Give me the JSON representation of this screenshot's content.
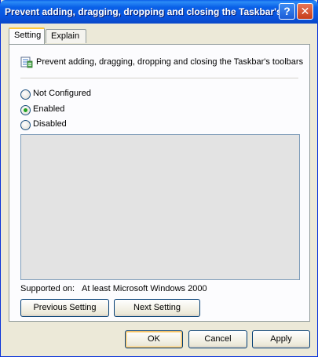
{
  "window": {
    "title": "Prevent adding, dragging, dropping and closing the Taskbar's ...",
    "help_label": "?",
    "close_label": "✕"
  },
  "tabs": [
    {
      "label": "Setting",
      "active": true
    },
    {
      "label": "Explain",
      "active": false
    }
  ],
  "policy": {
    "title": "Prevent adding, dragging, dropping and closing the Taskbar's toolbars",
    "icon": "policy-setting-icon"
  },
  "options": [
    {
      "label": "Not Configured",
      "checked": false
    },
    {
      "label": "Enabled",
      "checked": true
    },
    {
      "label": "Disabled",
      "checked": false
    }
  ],
  "comment": "",
  "supported": {
    "label": "Supported on:",
    "value": "At least Microsoft Windows 2000"
  },
  "nav": {
    "previous_label": "Previous Setting",
    "next_label": "Next Setting"
  },
  "footer": {
    "ok_label": "OK",
    "cancel_label": "Cancel",
    "apply_label": "Apply"
  }
}
